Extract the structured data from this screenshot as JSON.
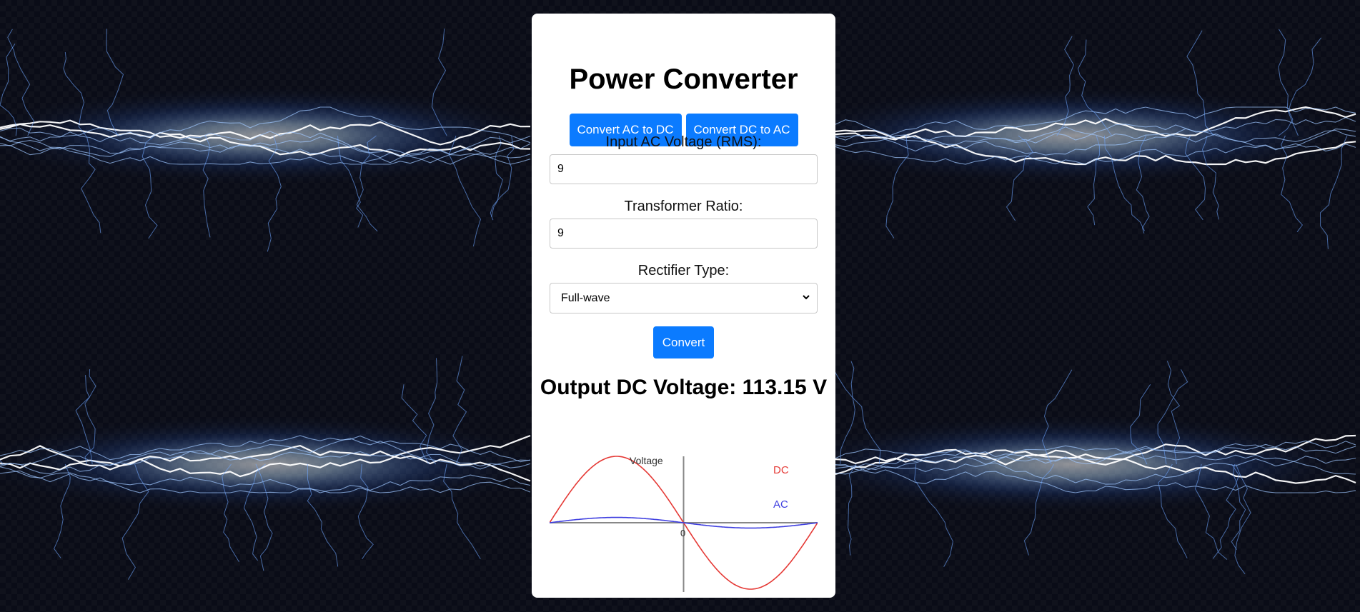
{
  "page": {
    "title": "Power Converter"
  },
  "modes": {
    "ac_to_dc_label": "Convert AC to DC",
    "dc_to_ac_label": "Convert DC to AC"
  },
  "form": {
    "voltage_label": "Input AC Voltage (RMS):",
    "voltage_value": "9",
    "ratio_label": "Transformer Ratio:",
    "ratio_value": "9",
    "rectifier_label": "Rectifier Type:",
    "rectifier_selected": "Full-wave",
    "convert_label": "Convert"
  },
  "output": {
    "text": "Output DC Voltage: 113.15 V"
  },
  "chart_data": {
    "type": "line",
    "ylabel": "Voltage",
    "origin_label": "0",
    "series": [
      {
        "name": "DC",
        "color": "#e53935",
        "waveform": "sine",
        "amplitude": 1.0,
        "cycles": 1
      },
      {
        "name": "AC",
        "color": "#3f3fe0",
        "waveform": "sine",
        "amplitude": 0.08,
        "cycles": 1
      }
    ],
    "grid": false
  },
  "colors": {
    "accent": "#0b7bff",
    "background": "#0a0c17",
    "card": "#ffffff"
  },
  "icons": {
    "select_caret": "chevron-down-icon"
  }
}
